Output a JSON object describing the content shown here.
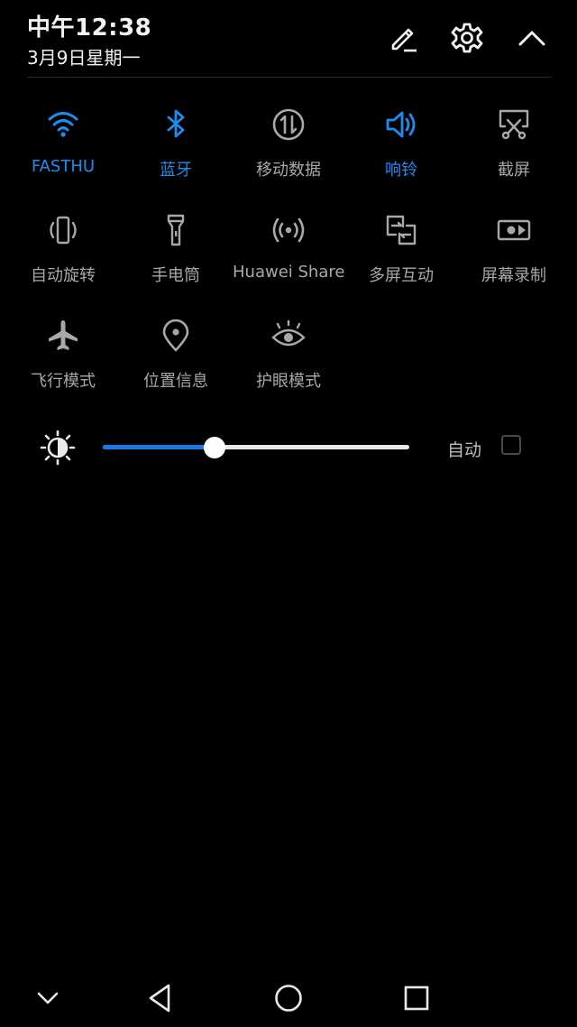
{
  "status": {
    "time": "中午12:38",
    "date": "3月9日星期一"
  },
  "header_actions": [
    {
      "name": "edit-icon"
    },
    {
      "name": "settings-icon"
    },
    {
      "name": "collapse-icon"
    }
  ],
  "colors": {
    "accent": "#1a8ef0",
    "inactive": "#a8a8a8",
    "background": "#000000",
    "slider_fill": "#1a78e8"
  },
  "tiles": [
    {
      "label": "FASTHU",
      "icon": "wifi-icon",
      "active": true
    },
    {
      "label": "蓝牙",
      "icon": "bluetooth-icon",
      "active": true
    },
    {
      "label": "移动数据",
      "icon": "mobile-data-icon",
      "active": false
    },
    {
      "label": "响铃",
      "icon": "ring-volume-icon",
      "active": true
    },
    {
      "label": "截屏",
      "icon": "screenshot-icon",
      "active": false
    },
    {
      "label": "自动旋转",
      "icon": "auto-rotate-icon",
      "active": false
    },
    {
      "label": "手电筒",
      "icon": "flashlight-icon",
      "active": false
    },
    {
      "label": "Huawei Share",
      "icon": "huawei-share-icon",
      "active": false
    },
    {
      "label": "多屏互动",
      "icon": "multi-screen-icon",
      "active": false
    },
    {
      "label": "屏幕录制",
      "icon": "screen-record-icon",
      "active": false
    },
    {
      "label": "飞行模式",
      "icon": "airplane-icon",
      "active": false
    },
    {
      "label": "位置信息",
      "icon": "location-icon",
      "active": false
    },
    {
      "label": "护眼模式",
      "icon": "eye-comfort-icon",
      "active": false
    }
  ],
  "brightness": {
    "level": 0.365,
    "auto_label": "自动",
    "auto_checked": false
  },
  "navbar": [
    {
      "name": "expand-down-icon"
    },
    {
      "name": "back-icon"
    },
    {
      "name": "home-icon"
    },
    {
      "name": "recents-icon"
    }
  ]
}
